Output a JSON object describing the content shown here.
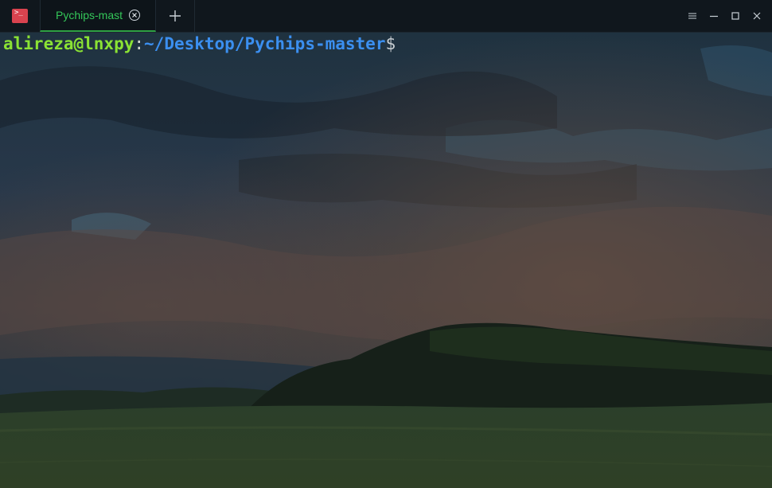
{
  "app": {
    "icon": "terminal-icon",
    "accent_color": "#2ea043"
  },
  "tabs": [
    {
      "title": "Pychips-mast",
      "active": true
    }
  ],
  "window_controls": {
    "menu_icon": "hamburger-menu-icon",
    "minimize_icon": "minimize-icon",
    "maximize_icon": "maximize-icon",
    "close_icon": "close-icon"
  },
  "terminal": {
    "prompt": {
      "user_host": "alireza@lnxpy",
      "separator": ":",
      "path": "~/Desktop/Pychips-master",
      "symbol": "$"
    },
    "colors": {
      "user_host": "#8ae234",
      "path": "#3b8ff0"
    },
    "background": "landscape-wallpaper"
  }
}
